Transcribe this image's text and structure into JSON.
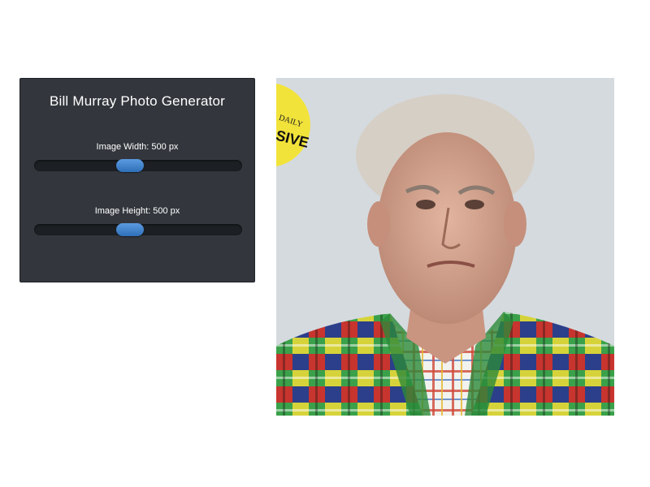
{
  "panel": {
    "title": "Bill Murray Photo Generator",
    "width_slider": {
      "label": "Image Width: 500 px",
      "value_fraction": 0.46
    },
    "height_slider": {
      "label": "Image Height: 500 px",
      "value_fraction": 0.46
    }
  },
  "photo": {
    "badge_top": "DAILY",
    "badge_bottom": "SIVE",
    "badge_color": "#f2e33a"
  },
  "colors": {
    "panel_bg": "#33373d",
    "accent": "#3f86d3"
  }
}
